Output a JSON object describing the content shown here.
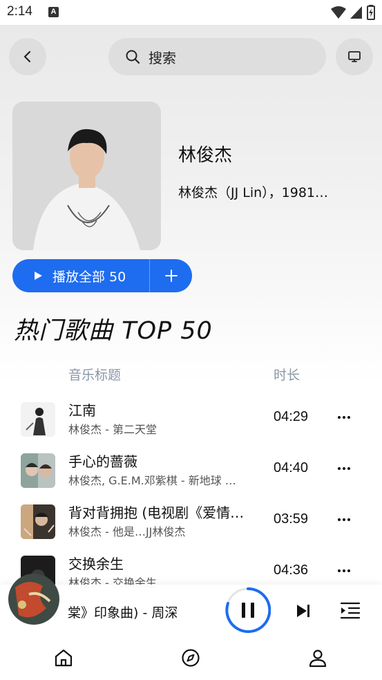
{
  "status_bar": {
    "time": "2:14",
    "notification_glyph": "A"
  },
  "top_bar": {
    "back_icon": "chevron-left-icon",
    "search_placeholder": "搜索",
    "cast_icon": "monitor-icon"
  },
  "artist": {
    "name": "林俊杰",
    "description": "林俊杰（JJ Lin），1981…"
  },
  "actions": {
    "play_all_label": "播放全部 50",
    "add_icon": "plus-icon"
  },
  "section_title": "热门歌曲 TOP 50",
  "columns": {
    "title": "音乐标题",
    "duration": "时长"
  },
  "songs": [
    {
      "title": "江南",
      "subtitle": "林俊杰 - 第二天堂",
      "duration": "04:29"
    },
    {
      "title": "手心的蔷薇",
      "subtitle": "林俊杰, G.E.M.邓紫棋 - 新地球 …",
      "duration": "04:40"
    },
    {
      "title": "背对背拥抱 (电视剧《爱情…",
      "subtitle": "林俊杰 - 他是…JJ林俊杰",
      "duration": "03:59"
    },
    {
      "title": "交换余生",
      "subtitle": "林俊杰 - 交换余生",
      "duration": "04:36"
    }
  ],
  "player": {
    "now_playing": "棠》印象曲) - 周深",
    "state": "playing"
  },
  "colors": {
    "accent": "#1e6cf0",
    "column_header": "#8a96a8"
  },
  "nav": [
    "home-icon",
    "compass-icon",
    "user-icon"
  ]
}
